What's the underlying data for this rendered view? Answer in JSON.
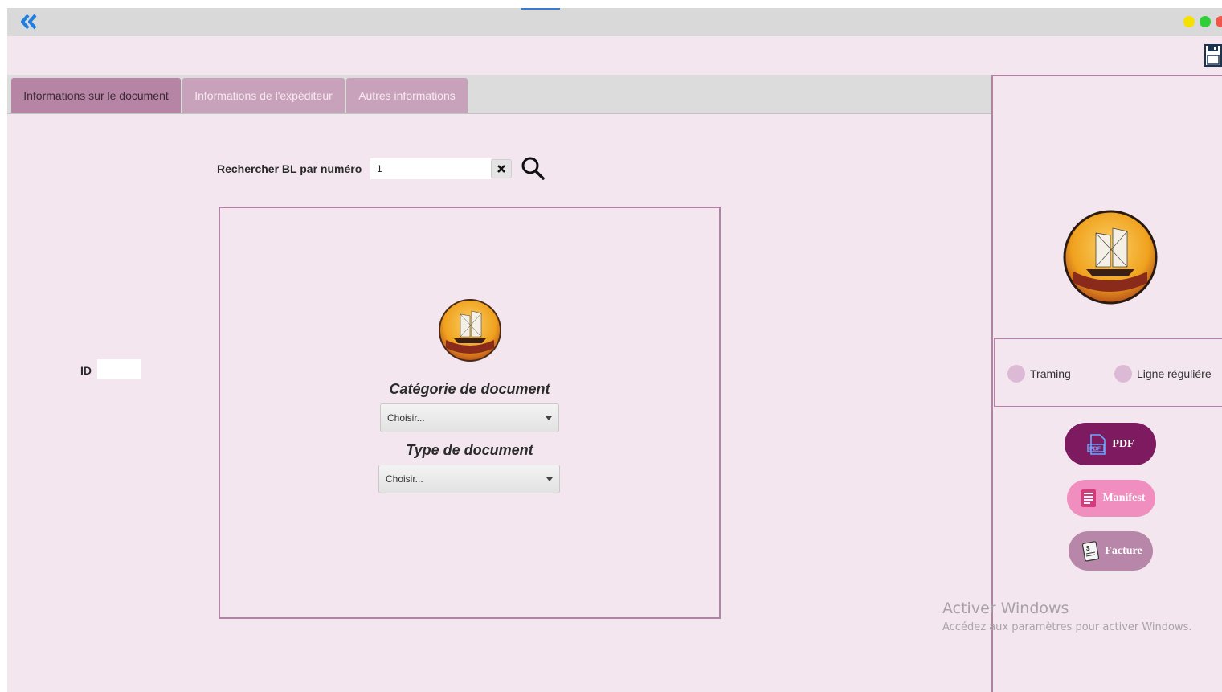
{
  "titlebar": {
    "back_icon": "double-chevron-left-icon",
    "window_controls": [
      "yellow",
      "green",
      "red"
    ]
  },
  "toolbar": {
    "save_icon": "floppy-disk-icon"
  },
  "tabs": [
    {
      "label": "Informations sur le document",
      "active": true
    },
    {
      "label": "Informations de l'expéditeur",
      "active": false
    },
    {
      "label": "Autres informations",
      "active": false
    }
  ],
  "search": {
    "label": "Rechercher BL par numéro",
    "value": "1",
    "clear_icon": "close-icon",
    "search_icon": "magnifier-icon"
  },
  "id_field": {
    "label": "ID",
    "value": ""
  },
  "document": {
    "category_label": "Catégorie de document",
    "category_value": "Choisir...",
    "type_label": "Type de document",
    "type_value": "Choisir..."
  },
  "options": {
    "traming_label": "Traming",
    "ligne_label": "Ligne réguliére"
  },
  "actions": {
    "pdf_label": "PDF",
    "manifest_label": "Manifest",
    "facture_label": "Facture"
  },
  "watermark": {
    "title": "Activer Windows",
    "subtitle": "Accédez aux paramètres pour activer Windows."
  },
  "colors": {
    "background": "#f3e6ef",
    "accent_border": "#b083a5",
    "tab_active": "#b685a6",
    "tab_inactive": "#c8a2bb",
    "pdf_button": "#7d1a60",
    "manifest_button": "#f08ec0",
    "facture_button": "#b886a8"
  }
}
